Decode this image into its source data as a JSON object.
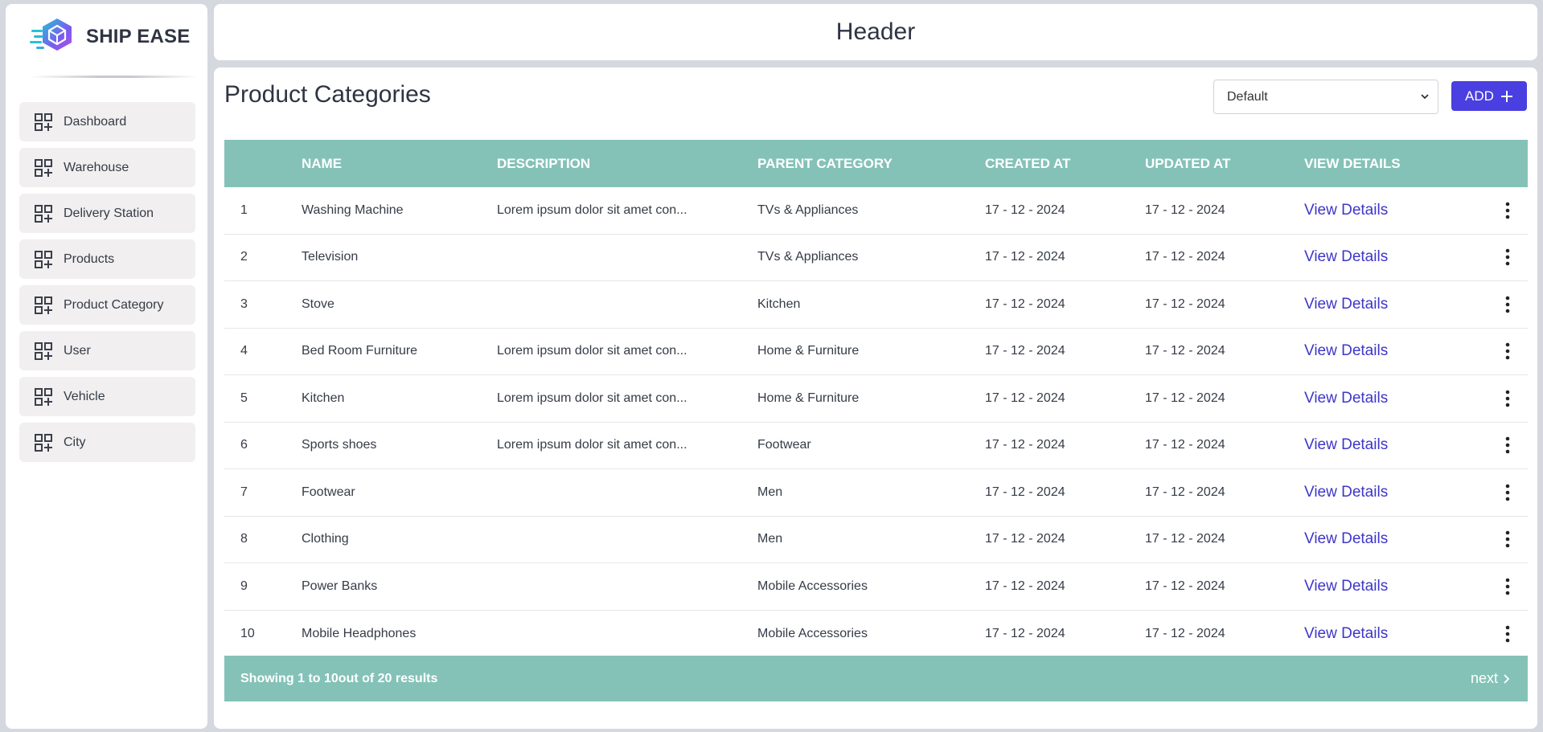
{
  "brand": {
    "name": "SHIP EASE"
  },
  "sidebar": {
    "items": [
      {
        "label": "Dashboard"
      },
      {
        "label": "Warehouse"
      },
      {
        "label": "Delivery Station"
      },
      {
        "label": "Products"
      },
      {
        "label": "Product Category"
      },
      {
        "label": "User"
      },
      {
        "label": "Vehicle"
      },
      {
        "label": "City"
      }
    ]
  },
  "header": {
    "title": "Header"
  },
  "main": {
    "title": "Product Categories",
    "select_value": "Default",
    "add_label": "ADD"
  },
  "table": {
    "columns": [
      "",
      "NAME",
      "DESCRIPTION",
      "PARENT CATEGORY",
      "CREATED AT",
      "UPDATED AT",
      "VIEW DETAILS"
    ],
    "rows": [
      {
        "id": "1",
        "name": "Washing Machine",
        "description": "Lorem ipsum dolor sit amet con...",
        "parent": "TVs & Appliances",
        "created": "17 - 12 - 2024",
        "updated": "17 - 12 - 2024",
        "link": "View Details"
      },
      {
        "id": "2",
        "name": "Television",
        "description": "",
        "parent": "TVs & Appliances",
        "created": "17 - 12 - 2024",
        "updated": "17 - 12 - 2024",
        "link": "View Details"
      },
      {
        "id": "3",
        "name": "Stove",
        "description": "",
        "parent": "Kitchen",
        "created": "17 - 12 - 2024",
        "updated": "17 - 12 - 2024",
        "link": "View Details"
      },
      {
        "id": "4",
        "name": "Bed Room Furniture",
        "description": "Lorem ipsum dolor sit amet con...",
        "parent": "Home & Furniture",
        "created": "17 - 12 - 2024",
        "updated": "17 - 12 - 2024",
        "link": "View Details"
      },
      {
        "id": "5",
        "name": "Kitchen",
        "description": "Lorem ipsum dolor sit amet con...",
        "parent": "Home & Furniture",
        "created": "17 - 12 - 2024",
        "updated": "17 - 12 - 2024",
        "link": "View Details"
      },
      {
        "id": "6",
        "name": "Sports shoes",
        "description": "Lorem ipsum dolor sit amet con...",
        "parent": "Footwear",
        "created": "17 - 12 - 2024",
        "updated": "17 - 12 - 2024",
        "link": "View Details"
      },
      {
        "id": "7",
        "name": "Footwear",
        "description": "",
        "parent": "Men",
        "created": "17 - 12 - 2024",
        "updated": "17 - 12 - 2024",
        "link": "View Details"
      },
      {
        "id": "8",
        "name": "Clothing",
        "description": "",
        "parent": "Men",
        "created": "17 - 12 - 2024",
        "updated": "17 - 12 - 2024",
        "link": "View Details"
      },
      {
        "id": "9",
        "name": "Power Banks",
        "description": "",
        "parent": "Mobile Accessories",
        "created": "17 - 12 - 2024",
        "updated": "17 - 12 - 2024",
        "link": "View Details"
      },
      {
        "id": "10",
        "name": "Mobile Headphones",
        "description": "",
        "parent": "Mobile Accessories",
        "created": "17 - 12 - 2024",
        "updated": "17 - 12 - 2024",
        "link": "View Details"
      }
    ]
  },
  "footer": {
    "summary": "Showing 1 to 10out of 20 results",
    "next_label": "next"
  },
  "icons": {
    "nav": "grid-plus-icon",
    "select": "chevron-down-icon",
    "add": "plus-icon",
    "row_menu": "more-vertical-icon",
    "next": "chevron-right-icon"
  },
  "colors": {
    "accent": "#4a3fe0",
    "table_header": "#84c2b8",
    "link": "#3d35c9"
  }
}
